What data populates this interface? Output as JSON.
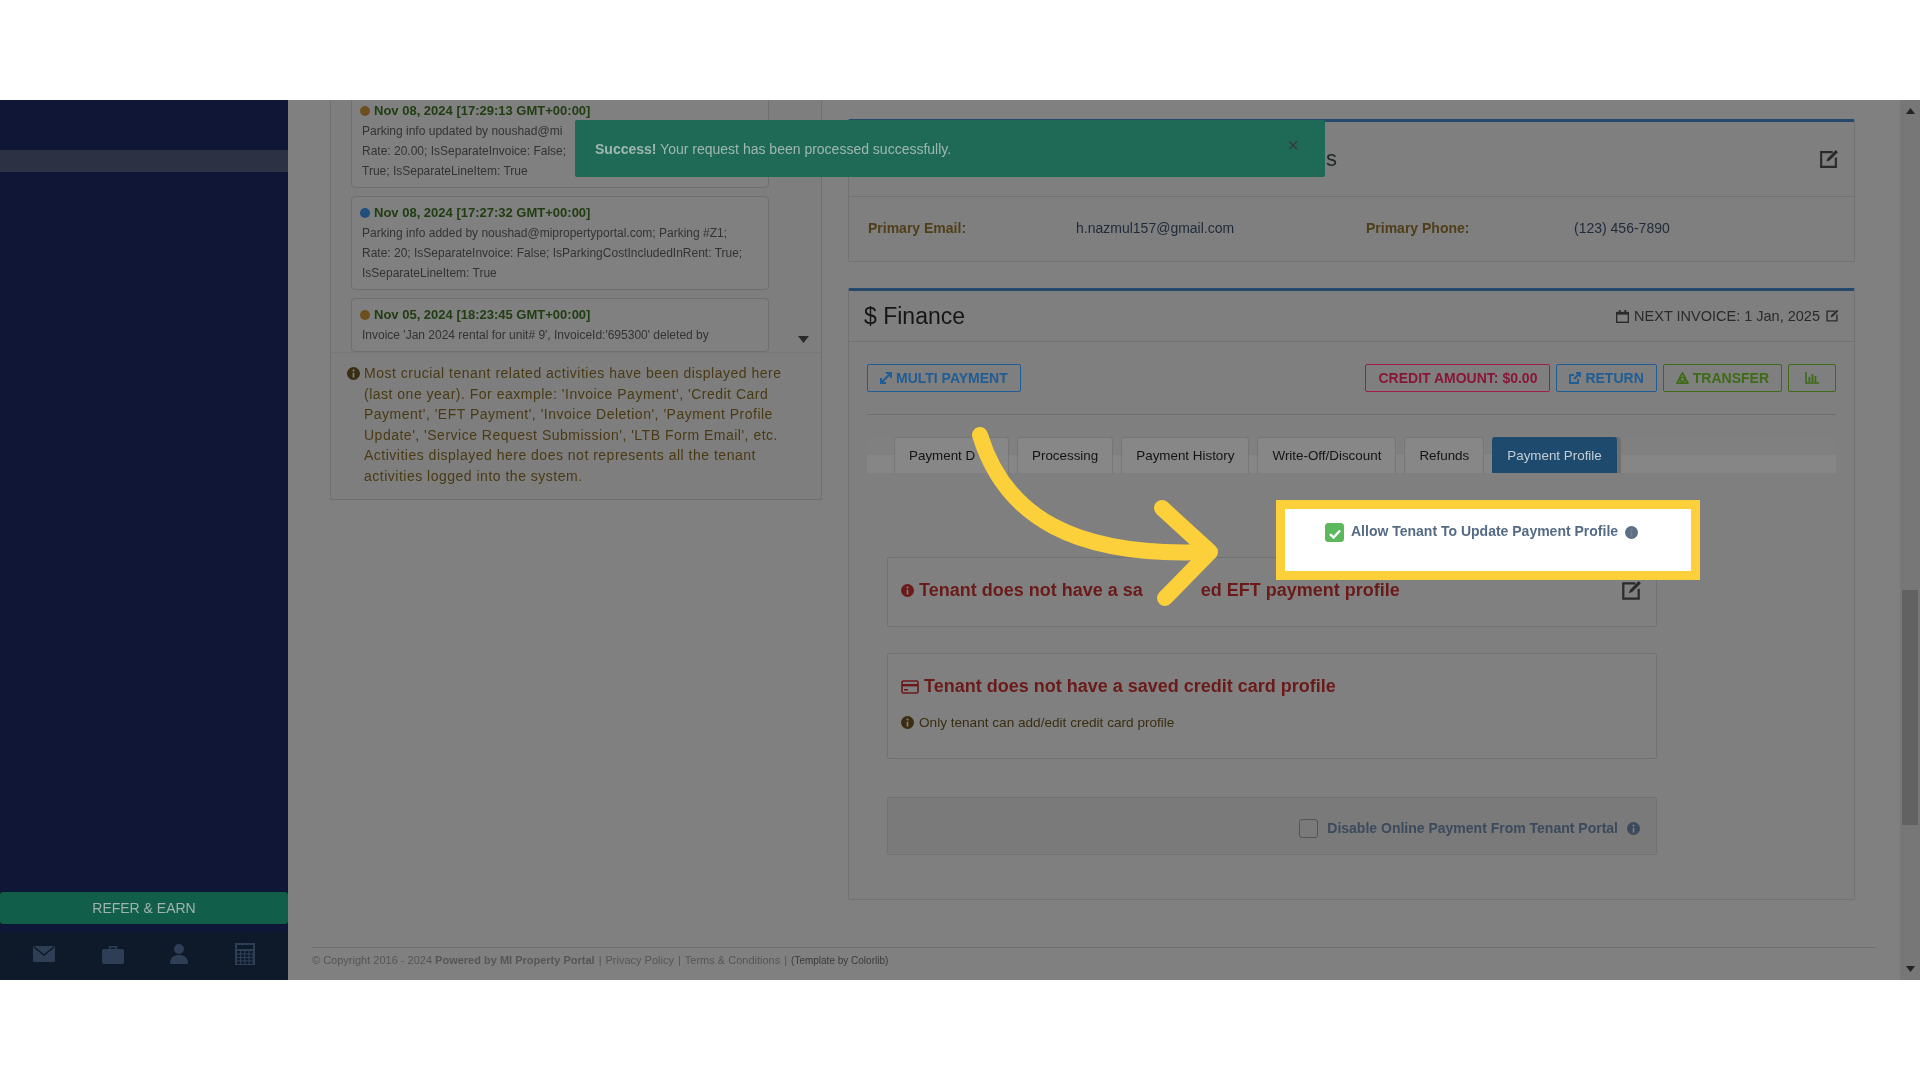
{
  "sidebar": {
    "refer_button": "REFER & EARN"
  },
  "toast": {
    "message": "**Success!** Your request has been processed successfully.",
    "close": "×"
  },
  "activity_log": {
    "entries": [
      {
        "date": "Nov 08, 2024 [17:29:13 GMT+00:00]",
        "color": "#6b4f1f",
        "lines": [
          "Parking info updated by noushad@mi",
          "Rate: 20.00; IsSeparateInvoice: False;",
          "True; IsSeparateLineItem: True"
        ]
      },
      {
        "date": "Nov 08, 2024 [17:27:32 GMT+00:00]",
        "color": "#1f4f7a",
        "lines": [
          "Parking info added by noushad@mipropertyportal.com; Parking #Z1;",
          "Rate: 20; IsSeparateInvoice: False; IsParkingCostIncludedInRent: True;",
          "IsSeparateLineItem: True"
        ]
      },
      {
        "date": "Nov 05, 2024 [18:23:45 GMT+00:00]",
        "color": "#6b4f1f",
        "lines": [
          "Invoice 'Jan 2024 rental for unit# 9', InvoiceId:'695300' deleted by"
        ]
      }
    ],
    "note": "Most crucial tenant related activities have been displayed here (last one year). For eaxmple: 'Invoice Payment', 'Credit Card Payment', 'EFT Payment', 'Invoice Deletion', 'Payment Profile Update', 'Service Request Submission', 'LTB Form Email', etc. Activities displayed here does not represents all the tenant activities logged into the system."
  },
  "communication": {
    "title": "s",
    "fields": [
      {
        "label": "Primary Email:",
        "value": "h.nazmul157@gmail.com"
      },
      {
        "label": "Primary Phone:",
        "value": "(123) 456-7890"
      }
    ]
  },
  "finance": {
    "title": "$ Finance",
    "next_invoice": "NEXT INVOICE: 1 Jan, 2025",
    "actions": [
      {
        "kind": "multi",
        "label": "MULTI PAYMENT"
      },
      {
        "kind": "credit",
        "label": "CREDIT AMOUNT: $0.00"
      },
      {
        "kind": "return",
        "label": "RETURN"
      },
      {
        "kind": "transfer",
        "label": "TRANSFER"
      },
      {
        "kind": "chart"
      }
    ],
    "tabs": [
      {
        "label": "Payment D",
        "selected": false
      },
      {
        "label": "Processing",
        "selected": false
      },
      {
        "label": "Payment History",
        "selected": false
      },
      {
        "label": "Write-Off/Discount",
        "selected": false
      },
      {
        "label": "Refunds",
        "selected": false
      },
      {
        "label": "Payment Profile",
        "selected": true
      }
    ],
    "allow_update": {
      "label": "Allow Tenant To Update Payment Profile",
      "checked": true
    },
    "eft": {
      "message_parts": [
        "Tenant does not have a sa",
        "ed EFT payment profile"
      ]
    },
    "credit_card": {
      "message": "Tenant does not have a saved credit card profile",
      "note": "Only tenant can add/edit credit card profile"
    },
    "disable_online": {
      "label": "Disable Online Payment From Tenant Portal",
      "checked": false
    }
  },
  "footer": [
    {
      "kind": "text",
      "text": "© Copyright 2016 - 2024 **Powered by MI Property Portal**"
    },
    {
      "kind": "separator",
      "text": "|"
    },
    {
      "kind": "link",
      "text": "Privacy Policy"
    },
    {
      "kind": "separator",
      "text": "|"
    },
    {
      "kind": "link",
      "text": "Terms & Conditions"
    },
    {
      "kind": "separator",
      "text": "|"
    },
    {
      "kind": "credit",
      "text": "(Template by Colorlib)"
    }
  ]
}
